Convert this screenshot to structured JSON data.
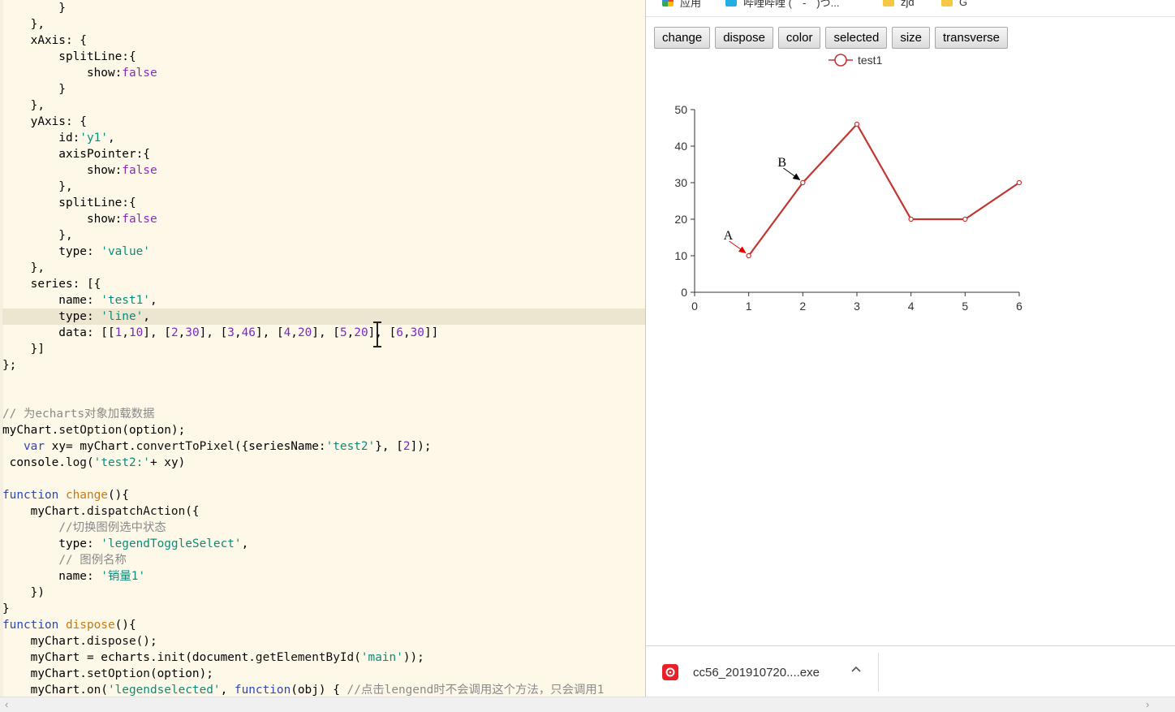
{
  "editor": {
    "lines": [
      "        }",
      "    },",
      "    xAxis: {",
      "        splitLine:{",
      "            show:false",
      "        }",
      "    },",
      "    yAxis: {",
      "        id:'y1',",
      "        axisPointer:{",
      "            show:false",
      "        },",
      "        splitLine:{",
      "            show:false",
      "        },",
      "        type: 'value'",
      "    },",
      "    series: [{",
      "        name: 'test1',",
      "        type: 'line',",
      "        data: [[1,10], [2,30], [3,46], [4,20], [5,20], [6,30]]",
      "    }]",
      "};",
      "",
      "",
      "// 为echarts对象加载数据",
      "myChart.setOption(option);",
      "   var xy= myChart.convertToPixel({seriesName:'test2'}, [2]);",
      " console.log('test2:'+ xy)",
      "",
      "function change(){",
      "    myChart.dispatchAction({",
      "        //切换图例选中状态",
      "        type: 'legendToggleSelect',",
      "        // 图例名称",
      "        name: '销量1'",
      "    })",
      "}",
      "function dispose(){",
      "    myChart.dispose();",
      "    myChart = echarts.init(document.getElementById('main'));",
      "    myChart.setOption(option);",
      "    myChart.on('legendselected', function(obj) { //点击lengend时不会调用这个方法，只会调用1"
    ],
    "highlighted_line": 19
  },
  "bookmarks": [
    {
      "label": "应用",
      "icon": "apps-icon",
      "color": "#4285f4"
    },
    {
      "label": "哔哩哔哩 (゜-゜)つ...",
      "icon": "bilibili-icon",
      "color": "#23ade5"
    },
    {
      "label": "zjd",
      "icon": "folder-icon",
      "color": "#f5c842"
    },
    {
      "label": "G",
      "icon": "folder-icon",
      "color": "#f5c842"
    }
  ],
  "toolbar": {
    "buttons": [
      "change",
      "dispose",
      "color",
      "selected",
      "size",
      "transverse"
    ]
  },
  "chart_data": {
    "type": "line",
    "series": [
      {
        "name": "test1",
        "x": [
          1,
          2,
          3,
          4,
          5,
          6
        ],
        "values": [
          10,
          30,
          46,
          20,
          20,
          30
        ],
        "color": "#c23531"
      }
    ],
    "xlim": [
      0,
      6
    ],
    "ylim": [
      0,
      50
    ],
    "xticks": [
      "0",
      "1",
      "2",
      "3",
      "4",
      "5",
      "6"
    ],
    "yticks": [
      "0",
      "10",
      "20",
      "30",
      "40",
      "50"
    ],
    "grid": false,
    "legend": "top-center",
    "annotations": [
      {
        "text": "A",
        "x": 1,
        "y": 10,
        "color": "#e00000"
      },
      {
        "text": "B",
        "x": 2,
        "y": 30,
        "color": "#000000"
      }
    ]
  },
  "download": {
    "filename": "cc56_201910720....exe",
    "icon": "netease-music-icon"
  },
  "colors": {
    "editor_bg": "#fdf8e8",
    "line_color": "#c23531",
    "keyword": "#2e48b0",
    "string": "#0e8a7a",
    "boolean": "#8a2bbd"
  }
}
